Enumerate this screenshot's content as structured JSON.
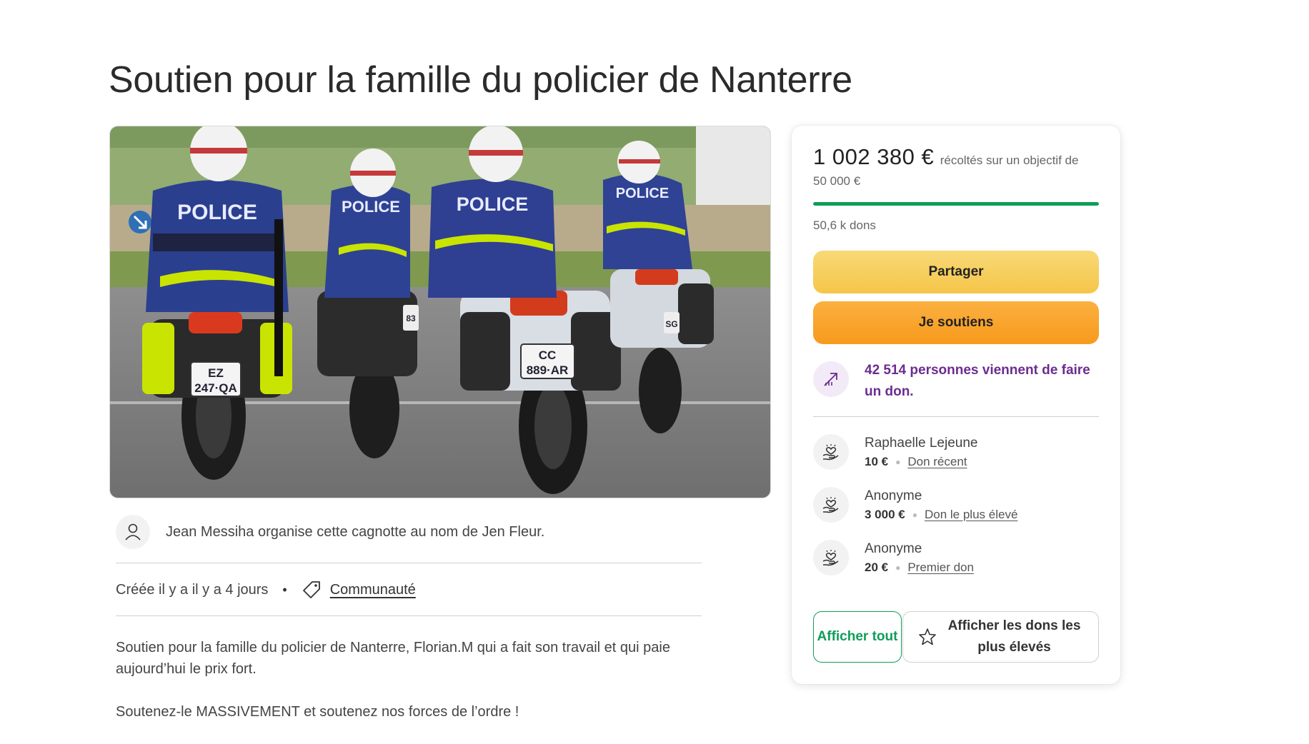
{
  "page": {
    "title": "Soutien pour la famille du policier de Nanterre"
  },
  "hero": {
    "vest_label": "POLICE",
    "plates": [
      "EZ",
      "247·QA",
      "CC",
      "889·AR",
      "83",
      "SG"
    ]
  },
  "organizer": {
    "text": "Jean Messiha organise cette cagnotte au nom de Jen Fleur.",
    "icon": "user-icon"
  },
  "meta": {
    "created": "Créée il y a il y a 4 jours",
    "bullet": "•",
    "category": "Communauté",
    "category_icon": "tag-icon"
  },
  "description": [
    "Soutien pour la famille du policier de Nanterre, Florian.M qui a fait son travail et qui paie aujourd’hui le prix fort.",
    "Soutenez-le MASSIVEMENT et soutenez nos forces de l’ordre !"
  ],
  "donation_card": {
    "amount_raised": "1 002 380 €",
    "raised_suffix": "récoltés sur un objectif de",
    "goal": "50 000 €",
    "progress_fraction": 1.0,
    "donation_count": "50,6 k dons",
    "share_label": "Partager",
    "donate_label": "Je soutiens",
    "trend_text": "42 514 personnes viennent de faire un don.",
    "trend_icon": "trending-up-icon",
    "donors": [
      {
        "name": "Raphaelle Lejeune",
        "amount": "10 €",
        "tag": "Don récent"
      },
      {
        "name": "Anonyme",
        "amount": "3 000 €",
        "tag": "Don le plus élevé"
      },
      {
        "name": "Anonyme",
        "amount": "20 €",
        "tag": "Premier don"
      }
    ],
    "show_all_label": "Afficher tout",
    "show_top_label": "Afficher les dons les plus élevés",
    "star_icon": "star-icon"
  },
  "colors": {
    "progress": "#0f9d58",
    "share_button": "#f5c548",
    "donate_button": "#f79a1c",
    "trend_text": "#6b2c91"
  }
}
